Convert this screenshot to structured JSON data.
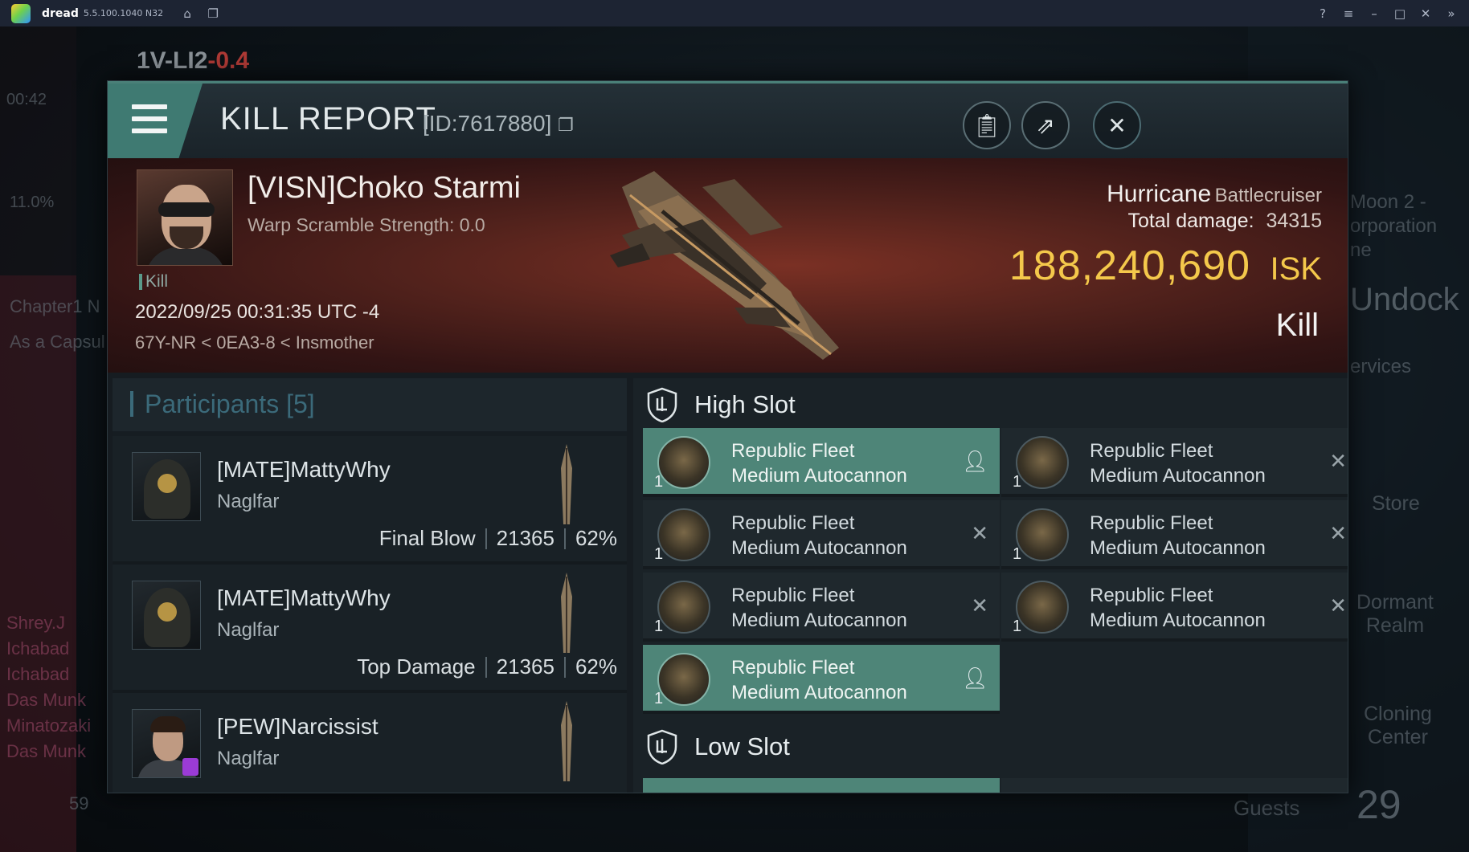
{
  "emulator": {
    "app_name": "dread",
    "version": "5.5.100.1040 N32"
  },
  "background": {
    "system_name": "1V-LI2",
    "security": "-0.4",
    "clock": "00:42",
    "percent": "11.0%",
    "left_labels": [
      "Chapter1 N",
      "As a Capsul"
    ],
    "chat_names": [
      "Shrey.J",
      "Ichabad",
      "Ichabad",
      "Das Munk",
      "Minatozaki",
      "Das Munk"
    ],
    "bottom_count": "59",
    "guests_label": "Guests",
    "guests_count": "29",
    "right_labels": {
      "moon": "Moon 2 -",
      "corporation": "orporation",
      "ne": "ne",
      "undock": "Undock",
      "services": "ervices",
      "store": "Store",
      "dormant_realm_line1": "Dormant",
      "dormant_realm_line2": "Realm",
      "cloning_center_line1": "Cloning",
      "cloning_center_line2": "Center"
    }
  },
  "report": {
    "title": "KILL REPORT",
    "id_text": "[ID:7617880]",
    "victim": {
      "name": "[VISN]Choko Starmi",
      "warp_scramble": "Warp Scramble Strength: 0.0",
      "tag": "Kill",
      "datetime": "2022/09/25 00:31:35 UTC -4",
      "location": "67Y-NR < 0EA3-8 < Insmother",
      "ship_name": "Hurricane",
      "ship_class": "Battlecruiser",
      "total_damage_label": "Total damage:",
      "total_damage": "34315",
      "isk_value": "188,240,690",
      "isk_unit": "ISK",
      "result": "Kill"
    },
    "participants": {
      "title": "Participants [5]",
      "rows": [
        {
          "name": "[MATE]MattyWhy",
          "ship": "Naglfar",
          "role": "Final Blow",
          "damage": "21365",
          "percent": "62%"
        },
        {
          "name": "[MATE]MattyWhy",
          "ship": "Naglfar",
          "role": "Top Damage",
          "damage": "21365",
          "percent": "62%"
        },
        {
          "name": "[PEW]Narcissist",
          "ship": "Naglfar",
          "role": "",
          "damage": "",
          "percent": ""
        }
      ]
    },
    "fittings": {
      "high_slot_label": "High Slot",
      "low_slot_label": "Low Slot",
      "high_modules": [
        {
          "line1": "Republic Fleet",
          "line2": "Medium Autocannon",
          "qty": "1",
          "state": "user"
        },
        {
          "line1": "Republic Fleet",
          "line2": "Medium Autocannon",
          "qty": "1",
          "state": "x"
        },
        {
          "line1": "Republic Fleet",
          "line2": "Medium Autocannon",
          "qty": "1",
          "state": "x"
        },
        {
          "line1": "Republic Fleet",
          "line2": "Medium Autocannon",
          "qty": "1",
          "state": "x"
        },
        {
          "line1": "Republic Fleet",
          "line2": "Medium Autocannon",
          "qty": "1",
          "state": "x"
        },
        {
          "line1": "Republic Fleet",
          "line2": "Medium Autocannon",
          "qty": "1",
          "state": "x"
        },
        {
          "line1": "Republic Fleet",
          "line2": "Medium Autocannon",
          "qty": "1",
          "state": "user"
        }
      ]
    }
  },
  "colors": {
    "accent_teal": "#4e8578",
    "isk_gold": "#f4c84b",
    "banner_red": "#52221c"
  }
}
